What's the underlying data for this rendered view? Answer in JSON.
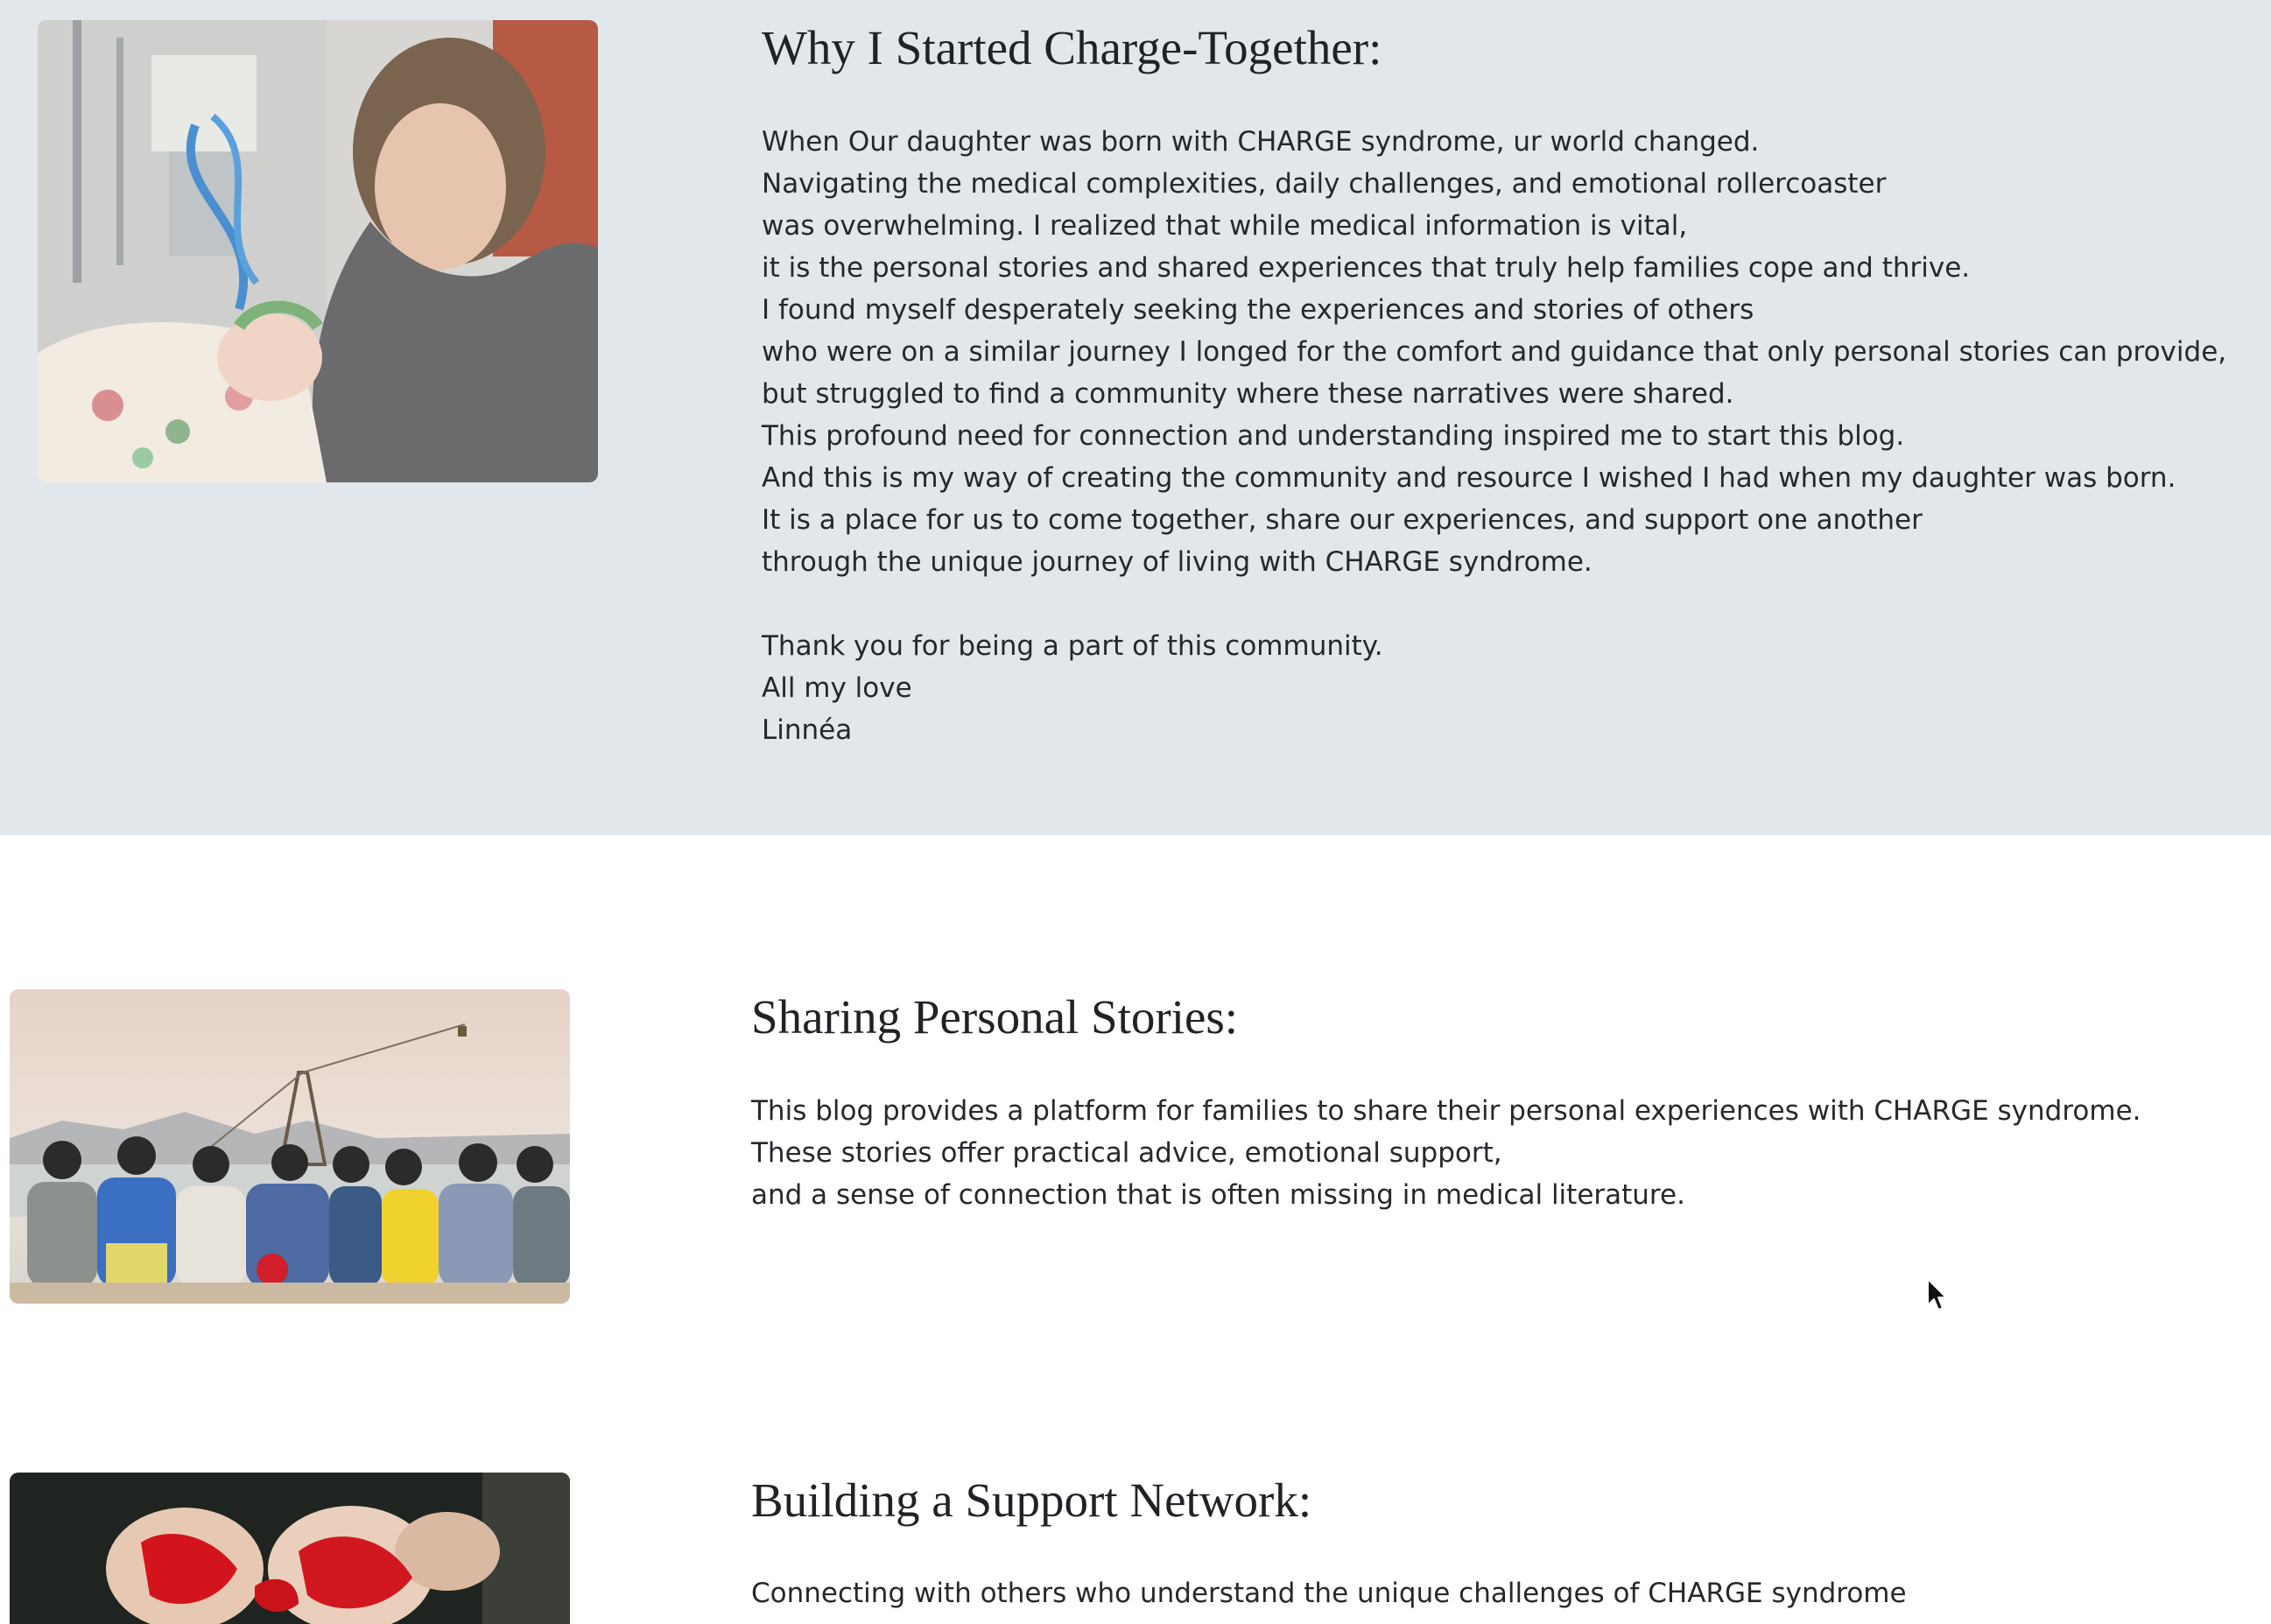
{
  "sections": {
    "why_started": {
      "heading": "Why I Started Charge-Together:",
      "lines": [
        "When Our daughter was born with CHARGE syndrome, ur world changed.",
        "Navigating the medical complexities, daily challenges, and emotional rollercoaster",
        "was overwhelming. I realized that while medical information is vital,",
        "it is the personal stories and shared experiences that truly help families cope and thrive.",
        "I found myself desperately seeking the experiences and stories of others",
        "who were on a similar journey I longed for the comfort and guidance that only personal stories can provide,",
        "but struggled to find a community where these narratives were shared.",
        "This profound need for connection and understanding inspired me to start this blog.",
        "And this is my way of creating the community and resource I wished I had when my daughter was born.",
        "It is a place for us to come together, share our experiences, and support one another",
        "through the unique journey of living with CHARGE syndrome."
      ],
      "closing": [
        "Thank you for being a part of this community.",
        "All my love",
        "Linnéa"
      ],
      "image": "mother-holding-newborn-in-hospital-photo"
    },
    "sharing": {
      "heading": "Sharing Personal Stories:",
      "lines": [
        "This blog provides a platform for families to share their personal experiences with CHARGE syndrome.",
        "These stories offer practical advice, emotional support,",
        "and a sense of connection that is often missing in medical literature."
      ],
      "image": "group-of-friends-arm-in-arm-photo"
    },
    "support": {
      "heading": "Building a Support Network:",
      "lines": [
        "Connecting with others who understand the unique challenges of CHARGE syndrome"
      ],
      "image": "red-painted-hands-photo"
    }
  },
  "colors": {
    "band_background": "#e2e7eb",
    "page_background": "#ffffff",
    "text": "#25282c"
  }
}
